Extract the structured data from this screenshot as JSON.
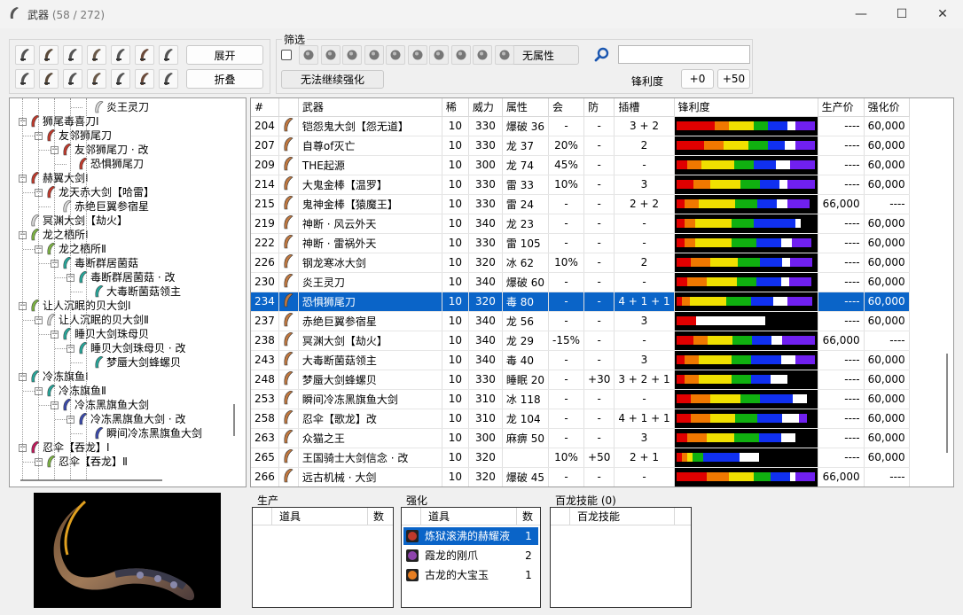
{
  "window": {
    "title": "武器",
    "count": "(58 / 272)",
    "minimize": "—",
    "maximize": "☐",
    "close": "✕"
  },
  "toolbar": {
    "expand_label": "展开",
    "collapse_label": "折叠",
    "weapon_type_icons": [
      "great-sword",
      "long-sword",
      "sword-shield",
      "dual-blades",
      "hammer",
      "hunting-horn",
      "lance",
      "gunlance",
      "switch-axe",
      "charge-blade",
      "insect-glaive",
      "light-bowgun",
      "heavy-bowgun",
      "bow"
    ]
  },
  "filter": {
    "title": "筛选",
    "element_icons": [
      "fire",
      "water",
      "thunder",
      "ice",
      "dragon",
      "poison",
      "sleep",
      "paralysis",
      "blast",
      "no-element"
    ],
    "no_element_label": "无属性",
    "no_upgrade_label": "无法继续强化",
    "sharpness_label": "锋利度",
    "plus0_label": "+0",
    "plus50_label": "+50",
    "search_value": "",
    "search_icon": "search-icon"
  },
  "tree": [
    {
      "depth": 4,
      "label": "炎王灵刀",
      "color": "#d8d8d8",
      "toggle": ""
    },
    {
      "depth": 0,
      "label": "狮尾毒喜刀Ⅰ",
      "color": "#c0392b",
      "toggle": "-"
    },
    {
      "depth": 1,
      "label": "友邻狮尾刀",
      "color": "#c0392b",
      "toggle": "-"
    },
    {
      "depth": 2,
      "label": "友邻狮尾刀 · 改",
      "color": "#c0392b",
      "toggle": "-"
    },
    {
      "depth": 3,
      "label": "恐惧狮尾刀",
      "color": "#c0392b",
      "toggle": ""
    },
    {
      "depth": 0,
      "label": "赫翼大剑Ⅰ",
      "color": "#c0392b",
      "toggle": "-"
    },
    {
      "depth": 1,
      "label": "龙天赤大剑【哈雷】",
      "color": "#c0392b",
      "toggle": "-"
    },
    {
      "depth": 2,
      "label": "赤绝巨翼参宿星",
      "color": "#d8d8d8",
      "toggle": ""
    },
    {
      "depth": 0,
      "label": "冥渊大剑【劫火】",
      "color": "#d8d8d8",
      "toggle": ""
    },
    {
      "depth": 0,
      "label": "龙之栖所Ⅰ",
      "color": "#7cb342",
      "toggle": "-"
    },
    {
      "depth": 1,
      "label": "龙之栖所Ⅱ",
      "color": "#7cb342",
      "toggle": "-"
    },
    {
      "depth": 2,
      "label": "毒断群居菌菇",
      "color": "#26a69a",
      "toggle": "-"
    },
    {
      "depth": 3,
      "label": "毒断群居菌菇 · 改",
      "color": "#26a69a",
      "toggle": "-"
    },
    {
      "depth": 4,
      "label": "大毒断菌菇领主",
      "color": "#26a69a",
      "toggle": ""
    },
    {
      "depth": 0,
      "label": "让人沉眠的贝大剑Ⅰ",
      "color": "#7cb342",
      "toggle": "-"
    },
    {
      "depth": 1,
      "label": "让人沉眠的贝大剑Ⅱ",
      "color": "#d8d8d8",
      "toggle": "-"
    },
    {
      "depth": 2,
      "label": "睡贝大剑珠母贝",
      "color": "#26a69a",
      "toggle": "-"
    },
    {
      "depth": 3,
      "label": "睡贝大剑珠母贝 · 改",
      "color": "#26a69a",
      "toggle": "-"
    },
    {
      "depth": 4,
      "label": "梦蜃大剑蜂螺贝",
      "color": "#26a69a",
      "toggle": ""
    },
    {
      "depth": 0,
      "label": "冷冻旗鱼Ⅰ",
      "color": "#26a69a",
      "toggle": "-"
    },
    {
      "depth": 1,
      "label": "冷冻旗鱼Ⅱ",
      "color": "#26a69a",
      "toggle": "-"
    },
    {
      "depth": 2,
      "label": "冷冻黑旗鱼大剑",
      "color": "#3949ab",
      "toggle": "-"
    },
    {
      "depth": 3,
      "label": "冷冻黑旗鱼大剑 · 改",
      "color": "#3949ab",
      "toggle": "-"
    },
    {
      "depth": 4,
      "label": "瞬间冷冻黑旗鱼大剑",
      "color": "#3949ab",
      "toggle": ""
    },
    {
      "depth": 0,
      "label": "忍伞【吞龙】Ⅰ",
      "color": "#c2185b",
      "toggle": "-"
    },
    {
      "depth": 1,
      "label": "忍伞【吞龙】Ⅱ",
      "color": "#7cb342",
      "toggle": "-"
    }
  ],
  "table": {
    "headers": [
      "#",
      "",
      "武器",
      "稀",
      "威力",
      "属性",
      "会",
      "防",
      "插槽",
      "锋利度",
      "生产价",
      "强化价"
    ],
    "rows": [
      {
        "id": "204",
        "name": "铠怨鬼大剑【怨无道】",
        "rarity": "10",
        "attack": "330",
        "element": "爆破 36",
        "affinity": "-",
        "defense": "-",
        "slots": "3 + 2",
        "produce": "----",
        "upgrade": "60,000",
        "sharp": [
          [
            0.28,
            "#e00000"
          ],
          [
            0.1,
            "#f07800"
          ],
          [
            0.18,
            "#f0e000"
          ],
          [
            0.1,
            "#10b010"
          ],
          [
            0.14,
            "#1030f0"
          ],
          [
            0.06,
            "#ffffff"
          ],
          [
            0.14,
            "#7020f0"
          ]
        ],
        "sel": false
      },
      {
        "id": "207",
        "name": "自尊of灭亡",
        "rarity": "10",
        "attack": "330",
        "element": "龙 37",
        "affinity": "20%",
        "defense": "-",
        "slots": "2",
        "produce": "----",
        "upgrade": "60,000",
        "sharp": [
          [
            0.2,
            "#e00000"
          ],
          [
            0.14,
            "#f07800"
          ],
          [
            0.18,
            "#f0e000"
          ],
          [
            0.14,
            "#10b010"
          ],
          [
            0.12,
            "#1030f0"
          ],
          [
            0.08,
            "#ffffff"
          ],
          [
            0.14,
            "#7020f0"
          ]
        ],
        "sel": false
      },
      {
        "id": "209",
        "name": "THE起源",
        "rarity": "10",
        "attack": "300",
        "element": "龙 74",
        "affinity": "45%",
        "defense": "-",
        "slots": "-",
        "produce": "----",
        "upgrade": "60,000",
        "sharp": [
          [
            0.08,
            "#e00000"
          ],
          [
            0.1,
            "#f07800"
          ],
          [
            0.24,
            "#f0e000"
          ],
          [
            0.14,
            "#10b010"
          ],
          [
            0.16,
            "#1030f0"
          ],
          [
            0.1,
            "#ffffff"
          ],
          [
            0.18,
            "#7020f0"
          ]
        ],
        "sel": false
      },
      {
        "id": "214",
        "name": "大鬼金棒【温罗】",
        "rarity": "10",
        "attack": "330",
        "element": "雷 33",
        "affinity": "10%",
        "defense": "-",
        "slots": "3",
        "produce": "----",
        "upgrade": "60,000",
        "sharp": [
          [
            0.12,
            "#e00000"
          ],
          [
            0.12,
            "#f07800"
          ],
          [
            0.22,
            "#f0e000"
          ],
          [
            0.14,
            "#10b010"
          ],
          [
            0.14,
            "#1030f0"
          ],
          [
            0.06,
            "#ffffff"
          ],
          [
            0.2,
            "#7020f0"
          ]
        ],
        "sel": false
      },
      {
        "id": "215",
        "name": "鬼神金棒【猿魔王】",
        "rarity": "10",
        "attack": "330",
        "element": "雷 24",
        "affinity": "-",
        "defense": "-",
        "slots": "2 + 2",
        "produce": "66,000",
        "upgrade": "----",
        "sharp": [
          [
            0.06,
            "#e00000"
          ],
          [
            0.1,
            "#f07800"
          ],
          [
            0.26,
            "#f0e000"
          ],
          [
            0.16,
            "#10b010"
          ],
          [
            0.14,
            "#1030f0"
          ],
          [
            0.08,
            "#ffffff"
          ],
          [
            0.16,
            "#7020f0"
          ]
        ],
        "sel": false
      },
      {
        "id": "219",
        "name": "神断 · 风云外天",
        "rarity": "10",
        "attack": "340",
        "element": "龙 23",
        "affinity": "-",
        "defense": "-",
        "slots": "-",
        "produce": "----",
        "upgrade": "60,000",
        "sharp": [
          [
            0.06,
            "#e00000"
          ],
          [
            0.08,
            "#f07800"
          ],
          [
            0.26,
            "#f0e000"
          ],
          [
            0.16,
            "#10b010"
          ],
          [
            0.3,
            "#1030f0"
          ],
          [
            0.04,
            "#ffffff"
          ],
          [
            0.0,
            "#7020f0"
          ]
        ],
        "sel": false
      },
      {
        "id": "222",
        "name": "神断 · 雷祸外天",
        "rarity": "10",
        "attack": "330",
        "element": "雷 105",
        "affinity": "-",
        "defense": "-",
        "slots": "-",
        "produce": "----",
        "upgrade": "60,000",
        "sharp": [
          [
            0.06,
            "#e00000"
          ],
          [
            0.08,
            "#f07800"
          ],
          [
            0.26,
            "#f0e000"
          ],
          [
            0.18,
            "#10b010"
          ],
          [
            0.18,
            "#1030f0"
          ],
          [
            0.08,
            "#ffffff"
          ],
          [
            0.14,
            "#7020f0"
          ]
        ],
        "sel": false
      },
      {
        "id": "226",
        "name": "钢龙寒冰大剑",
        "rarity": "10",
        "attack": "320",
        "element": "冰 62",
        "affinity": "10%",
        "defense": "-",
        "slots": "2",
        "produce": "----",
        "upgrade": "60,000",
        "sharp": [
          [
            0.1,
            "#e00000"
          ],
          [
            0.14,
            "#f07800"
          ],
          [
            0.2,
            "#f0e000"
          ],
          [
            0.16,
            "#10b010"
          ],
          [
            0.16,
            "#1030f0"
          ],
          [
            0.06,
            "#ffffff"
          ],
          [
            0.16,
            "#7020f0"
          ]
        ],
        "sel": false
      },
      {
        "id": "230",
        "name": "炎王灵刀",
        "rarity": "10",
        "attack": "340",
        "element": "爆破 60",
        "affinity": "-",
        "defense": "-",
        "slots": "-",
        "produce": "----",
        "upgrade": "60,000",
        "sharp": [
          [
            0.08,
            "#e00000"
          ],
          [
            0.14,
            "#f07800"
          ],
          [
            0.22,
            "#f0e000"
          ],
          [
            0.14,
            "#10b010"
          ],
          [
            0.18,
            "#1030f0"
          ],
          [
            0.06,
            "#ffffff"
          ],
          [
            0.16,
            "#7020f0"
          ]
        ],
        "sel": false
      },
      {
        "id": "234",
        "name": "恐惧狮尾刀",
        "rarity": "10",
        "attack": "320",
        "element": "毒 80",
        "affinity": "-",
        "defense": "-",
        "slots": "4 + 1 + 1",
        "produce": "----",
        "upgrade": "60,000",
        "sharp": [
          [
            0.04,
            "#e00000"
          ],
          [
            0.06,
            "#f07800"
          ],
          [
            0.26,
            "#f0e000"
          ],
          [
            0.18,
            "#10b010"
          ],
          [
            0.16,
            "#1030f0"
          ],
          [
            0.1,
            "#ffffff"
          ],
          [
            0.18,
            "#7020f0"
          ]
        ],
        "sel": true
      },
      {
        "id": "237",
        "name": "赤绝巨翼参宿星",
        "rarity": "10",
        "attack": "340",
        "element": "龙 56",
        "affinity": "-",
        "defense": "-",
        "slots": "3",
        "produce": "----",
        "upgrade": "60,000",
        "sharp": [
          [
            0.14,
            "#e00000"
          ],
          [
            0.0,
            "#f07800"
          ],
          [
            0.0,
            "#f0e000"
          ],
          [
            0.0,
            "#10b010"
          ],
          [
            0.0,
            "#1030f0"
          ],
          [
            0.5,
            "#ffffff"
          ],
          [
            0.0,
            "#7020f0"
          ]
        ],
        "sel": false
      },
      {
        "id": "238",
        "name": "冥渊大剑【劫火】",
        "rarity": "10",
        "attack": "340",
        "element": "龙 29",
        "affinity": "-15%",
        "defense": "-",
        "slots": "-",
        "produce": "66,000",
        "upgrade": "----",
        "sharp": [
          [
            0.12,
            "#e00000"
          ],
          [
            0.1,
            "#f07800"
          ],
          [
            0.18,
            "#f0e000"
          ],
          [
            0.14,
            "#10b010"
          ],
          [
            0.14,
            "#1030f0"
          ],
          [
            0.08,
            "#ffffff"
          ],
          [
            0.24,
            "#7020f0"
          ]
        ],
        "sel": false
      },
      {
        "id": "243",
        "name": "大毒断菌菇领主",
        "rarity": "10",
        "attack": "340",
        "element": "毒 40",
        "affinity": "-",
        "defense": "-",
        "slots": "3",
        "produce": "----",
        "upgrade": "60,000",
        "sharp": [
          [
            0.06,
            "#e00000"
          ],
          [
            0.1,
            "#f07800"
          ],
          [
            0.24,
            "#f0e000"
          ],
          [
            0.14,
            "#10b010"
          ],
          [
            0.22,
            "#1030f0"
          ],
          [
            0.1,
            "#ffffff"
          ],
          [
            0.14,
            "#7020f0"
          ]
        ],
        "sel": false
      },
      {
        "id": "248",
        "name": "梦蜃大剑蜂螺贝",
        "rarity": "10",
        "attack": "330",
        "element": "睡眠 20",
        "affinity": "-",
        "defense": "+30",
        "slots": "3 + 2 + 1",
        "produce": "----",
        "upgrade": "60,000",
        "sharp": [
          [
            0.06,
            "#e00000"
          ],
          [
            0.1,
            "#f07800"
          ],
          [
            0.24,
            "#f0e000"
          ],
          [
            0.14,
            "#10b010"
          ],
          [
            0.14,
            "#1030f0"
          ],
          [
            0.12,
            "#ffffff"
          ],
          [
            0.0,
            "#7020f0"
          ]
        ],
        "sel": false
      },
      {
        "id": "253",
        "name": "瞬间冷冻黑旗鱼大剑",
        "rarity": "10",
        "attack": "310",
        "element": "冰 118",
        "affinity": "-",
        "defense": "-",
        "slots": "-",
        "produce": "----",
        "upgrade": "60,000",
        "sharp": [
          [
            0.1,
            "#e00000"
          ],
          [
            0.14,
            "#f07800"
          ],
          [
            0.22,
            "#f0e000"
          ],
          [
            0.14,
            "#10b010"
          ],
          [
            0.24,
            "#1030f0"
          ],
          [
            0.1,
            "#ffffff"
          ],
          [
            0.0,
            "#7020f0"
          ]
        ],
        "sel": false
      },
      {
        "id": "258",
        "name": "忍伞【歌龙】改",
        "rarity": "10",
        "attack": "310",
        "element": "龙 104",
        "affinity": "-",
        "defense": "-",
        "slots": "4 + 1 + 1",
        "produce": "----",
        "upgrade": "60,000",
        "sharp": [
          [
            0.1,
            "#e00000"
          ],
          [
            0.14,
            "#f07800"
          ],
          [
            0.18,
            "#f0e000"
          ],
          [
            0.16,
            "#10b010"
          ],
          [
            0.18,
            "#1030f0"
          ],
          [
            0.12,
            "#ffffff"
          ],
          [
            0.06,
            "#7020f0"
          ]
        ],
        "sel": false
      },
      {
        "id": "263",
        "name": "众猫之王",
        "rarity": "10",
        "attack": "300",
        "element": "麻痹 50",
        "affinity": "-",
        "defense": "-",
        "slots": "3",
        "produce": "----",
        "upgrade": "60,000",
        "sharp": [
          [
            0.08,
            "#e00000"
          ],
          [
            0.14,
            "#f07800"
          ],
          [
            0.2,
            "#f0e000"
          ],
          [
            0.18,
            "#10b010"
          ],
          [
            0.16,
            "#1030f0"
          ],
          [
            0.1,
            "#ffffff"
          ],
          [
            0.0,
            "#7020f0"
          ]
        ],
        "sel": false
      },
      {
        "id": "265",
        "name": "王国骑士大剑信念 · 改",
        "rarity": "10",
        "attack": "320",
        "element": "",
        "affinity": "10%",
        "defense": "+50",
        "slots": "2 + 1",
        "produce": "----",
        "upgrade": "60,000",
        "sharp": [
          [
            0.04,
            "#e00000"
          ],
          [
            0.04,
            "#f07800"
          ],
          [
            0.04,
            "#f0e000"
          ],
          [
            0.08,
            "#10b010"
          ],
          [
            0.26,
            "#1030f0"
          ],
          [
            0.14,
            "#ffffff"
          ],
          [
            0.0,
            "#7020f0"
          ]
        ],
        "sel": false
      },
      {
        "id": "266",
        "name": "远古机械 · 大剑",
        "rarity": "10",
        "attack": "320",
        "element": "爆破 45",
        "affinity": "-",
        "defense": "-",
        "slots": "-",
        "produce": "66,000",
        "upgrade": "----",
        "sharp": [
          [
            0.22,
            "#e00000"
          ],
          [
            0.16,
            "#f07800"
          ],
          [
            0.18,
            "#f0e000"
          ],
          [
            0.12,
            "#10b010"
          ],
          [
            0.14,
            "#1030f0"
          ],
          [
            0.04,
            "#ffffff"
          ],
          [
            0.14,
            "#7020f0"
          ]
        ],
        "sel": false
      }
    ]
  },
  "produce_panel": {
    "title": "生产",
    "col_item": "道具",
    "col_count": "数"
  },
  "upgrade_panel": {
    "title": "强化",
    "col_item": "道具",
    "col_count": "数",
    "items": [
      {
        "name": "炼狱滚沸的赫耀液",
        "count": "1",
        "icon": "flask-icon",
        "color": "#c0392b"
      },
      {
        "name": "霞龙的刚爪",
        "count": "2",
        "icon": "claw-icon",
        "color": "#8e44ad"
      },
      {
        "name": "古龙的大宝玉",
        "count": "1",
        "icon": "gem-icon",
        "color": "#e67e22"
      }
    ]
  },
  "skill_panel": {
    "title": "百龙技能",
    "count": "(0)",
    "col_skill": "百龙技能"
  }
}
